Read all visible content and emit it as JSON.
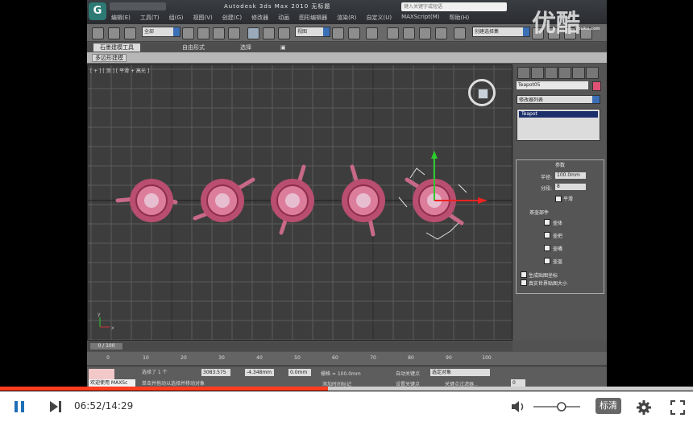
{
  "titlebar": {
    "logo": "G",
    "title": "Autodesk 3ds Max  2010    无标题",
    "search_placeholder": "键入关键字或短语"
  },
  "menus": [
    "编辑(E)",
    "工具(T)",
    "组(G)",
    "视图(V)",
    "创建(C)",
    "修改器",
    "动画",
    "图形编辑器",
    "渲染(R)",
    "自定义(U)",
    "MAXScript(M)",
    "帮助(H)"
  ],
  "toolbar": {
    "filter_label": "全部",
    "view_label": "视图",
    "selection_set": "创建选择集"
  },
  "ribbon": {
    "tabs": [
      "石墨建模工具",
      "自由形式",
      "选择",
      "▣"
    ],
    "subtab": "多边形建模"
  },
  "viewport": {
    "label": "[ + ] [ 顶 ] [ 平滑 + 高光 ]",
    "axis_x": "x",
    "axis_y": "y"
  },
  "command_panel": {
    "object_name": "Teapot05",
    "color": "#e05275",
    "modifier_list": "修改器列表",
    "stack_item": "Teapot",
    "params_title": "参数",
    "radius_label": "半径:",
    "radius_value": "100.0mm",
    "segments_label": "分段:",
    "segments_value": "8",
    "smooth_label": "平滑",
    "parts_label": "茶壶部件",
    "parts": [
      "壶体",
      "壶把",
      "壶嘴",
      "壶盖"
    ],
    "gen_mapping": "生成贴图坐标",
    "real_world": "真实世界贴图大小"
  },
  "timeline": {
    "frame": "0 / 100",
    "ticks": [
      "0",
      "10",
      "20",
      "30",
      "40",
      "50",
      "60",
      "70",
      "80",
      "90",
      "100"
    ]
  },
  "status": {
    "listener": "欢迎使用 MAXSc",
    "selected": "选择了 1 个",
    "prompt": "单击并拖动以选择并移动对象",
    "x": "3083.575",
    "y": "-4.348mm",
    "z": "0.0mm",
    "grid": "栅格 = 100.0mm",
    "add_time_tag": "添加时间标记",
    "auto_key": "自动关键点",
    "selected_obj": "选定对象",
    "set_key": "设置关键点",
    "key_filters": "关键点过滤器...",
    "frame_field": "0"
  },
  "player": {
    "time": "06:52/14:29",
    "progress": 0.473,
    "quality": "标清",
    "volume": 0.6
  },
  "watermark": {
    "text": "优酷",
    "sub": "youku.com"
  }
}
